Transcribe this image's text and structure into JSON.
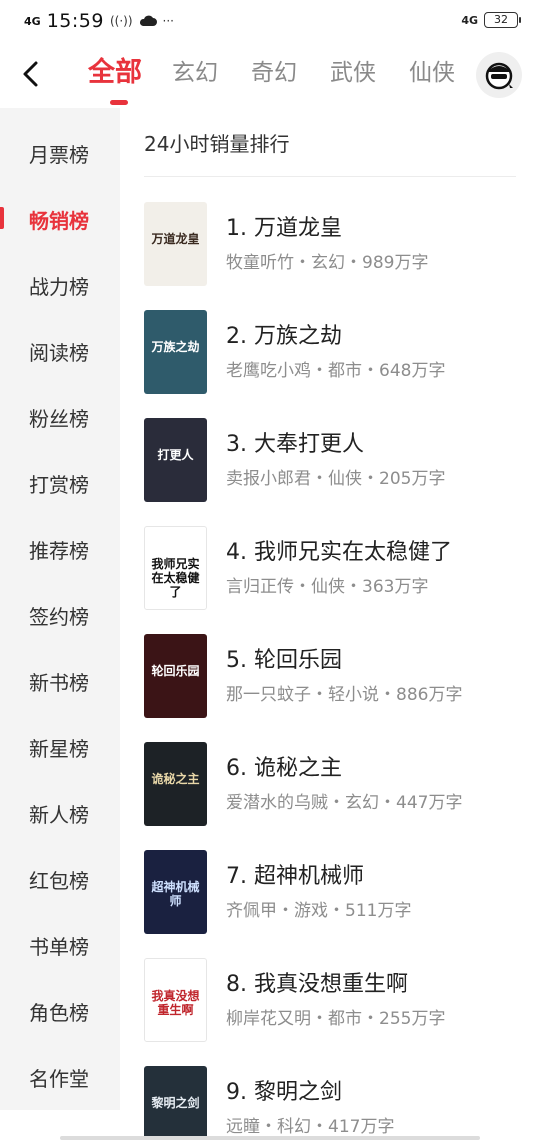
{
  "status": {
    "network": "4G",
    "time": "15:59",
    "extra": "···",
    "signal": "4G",
    "battery": "32"
  },
  "header": {
    "tabs": [
      {
        "label": "全部"
      },
      {
        "label": "玄幻"
      },
      {
        "label": "奇幻"
      },
      {
        "label": "武侠"
      },
      {
        "label": "仙侠"
      }
    ],
    "active_tab": 0
  },
  "sidebar": {
    "items": [
      {
        "label": "月票榜"
      },
      {
        "label": "畅销榜"
      },
      {
        "label": "战力榜"
      },
      {
        "label": "阅读榜"
      },
      {
        "label": "粉丝榜"
      },
      {
        "label": "打赏榜"
      },
      {
        "label": "推荐榜"
      },
      {
        "label": "签约榜"
      },
      {
        "label": "新书榜"
      },
      {
        "label": "新星榜"
      },
      {
        "label": "新人榜"
      },
      {
        "label": "红包榜"
      },
      {
        "label": "书单榜"
      },
      {
        "label": "角色榜"
      },
      {
        "label": "名作堂"
      }
    ],
    "active_index": 1
  },
  "main": {
    "section_title": "24小时销量排行",
    "books": [
      {
        "title": "1. 万道龙皇",
        "meta": "牧童听竹・玄幻・989万字",
        "cover_text": "万道龙皇",
        "cover_bg": "#f2efe9",
        "cover_fg": "#3a2a20"
      },
      {
        "title": "2. 万族之劫",
        "meta": "老鹰吃小鸡・都市・648万字",
        "cover_text": "万族之劫",
        "cover_bg": "#2f5b6b",
        "cover_fg": "#ffffff"
      },
      {
        "title": "3. 大奉打更人",
        "meta": "卖报小郎君・仙侠・205万字",
        "cover_text": "打更人",
        "cover_bg": "#2a2c3a",
        "cover_fg": "#ffffff"
      },
      {
        "title": "4. 我师兄实在太稳健了",
        "meta": "言归正传・仙侠・363万字",
        "cover_text": "我师兄实在太稳健了",
        "cover_bg": "#ffffff",
        "cover_fg": "#111111"
      },
      {
        "title": "5. 轮回乐园",
        "meta": "那一只蚊子・轻小说・886万字",
        "cover_text": "轮回乐园",
        "cover_bg": "#3b1416",
        "cover_fg": "#ffffff"
      },
      {
        "title": "6. 诡秘之主",
        "meta": "爱潜水的乌贼・玄幻・447万字",
        "cover_text": "诡秘之主",
        "cover_bg": "#1d2226",
        "cover_fg": "#e8d7a8"
      },
      {
        "title": "7. 超神机械师",
        "meta": "齐佩甲・游戏・511万字",
        "cover_text": "超神机械师",
        "cover_bg": "#1a2140",
        "cover_fg": "#cfe1ff"
      },
      {
        "title": "8. 我真没想重生啊",
        "meta": "柳岸花又明・都市・255万字",
        "cover_text": "我真没想重生啊",
        "cover_bg": "#ffffff",
        "cover_fg": "#c0262d"
      },
      {
        "title": "9. 黎明之剑",
        "meta": "远瞳・科幻・417万字",
        "cover_text": "黎明之剑",
        "cover_bg": "#24303a",
        "cover_fg": "#e8eef4"
      }
    ]
  },
  "colors": {
    "accent": "#e8333c",
    "sidebar_bg": "#f4f4f4",
    "meta_text": "#8d8d8d"
  },
  "icons": {
    "back": "back-arrow-icon",
    "avatar": "user-avatar-icon"
  }
}
